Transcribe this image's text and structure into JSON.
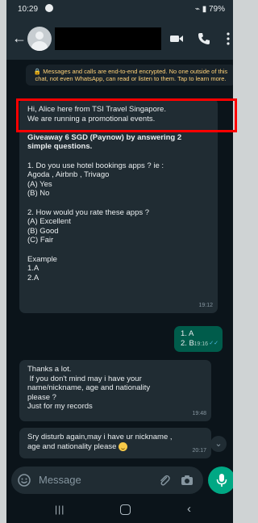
{
  "status": {
    "time": "10:29",
    "battery": "79%"
  },
  "header": {
    "contact_name_redacted": true
  },
  "notice": "Messages and calls are end-to-end encrypted. No one outside of this chat, not even WhatsApp, can read or listen to them. Tap to learn more.",
  "messages": [
    {
      "direction": "in",
      "lines": [
        "Hi, Alice here from TSI Travel Singapore.",
        "We are running a promotional events.",
        "",
        "Giveaway 6 SGD (Paynow) by answering 2",
        "simple questions.",
        "",
        "1. Do you use hotel bookings apps ? ie :",
        "Agoda , Airbnb , Trivago",
        "(A) Yes",
        "(B) No",
        "",
        "2. How would you rate these apps ?",
        "(A) Excellent",
        "(B) Good",
        "(C) Fair",
        "",
        "Example",
        "1.A",
        "2.A"
      ],
      "time": "19:12"
    },
    {
      "direction": "out",
      "lines": [
        "1. A",
        "2. B"
      ],
      "time": "19:16"
    },
    {
      "direction": "in",
      "lines": [
        "Thanks a lot.",
        " If you don't mind may i have your",
        "name/nickname, age and nationality",
        "please ?",
        "Just for my records"
      ],
      "time": "19:48"
    },
    {
      "direction": "in",
      "lines": [
        "Sry disturb again,may i have ur nickname ,",
        "age and nationality please"
      ],
      "time": "20:17"
    }
  ],
  "input": {
    "placeholder": "Message"
  },
  "colors": {
    "highlight": "#ff0000",
    "outgoing": "#005c4b",
    "incoming": "#202c33",
    "accent": "#00a884"
  }
}
